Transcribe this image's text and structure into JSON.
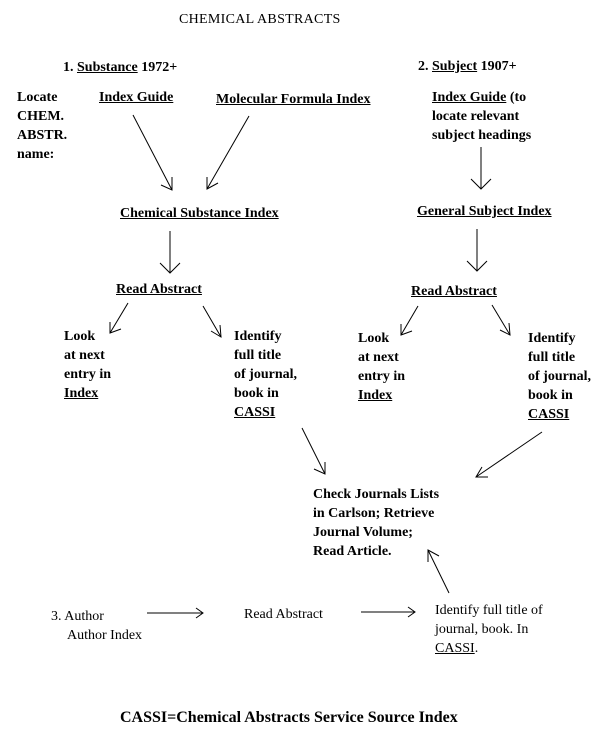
{
  "title": "CHEMICAL   ABSTRACTS",
  "section1": {
    "number": "1.",
    "name": "Substance",
    "years": "1972+",
    "locate_lines": [
      "Locate",
      "CHEM.",
      "ABSTR.",
      "name:"
    ],
    "index_guide": "Index Guide",
    "molecular_formula_index": "Molecular Formula Index",
    "chemical_substance_index": "Chemical Substance Index",
    "read_abstract": "Read Abstract",
    "look_lines": [
      "Look",
      "at next",
      "entry in"
    ],
    "look_index": "Index",
    "identify_lines": [
      "Identify",
      "full title",
      "of journal,",
      "book in"
    ],
    "identify_cassi": "CASSI"
  },
  "section2": {
    "number": "2.",
    "name": "Subject",
    "years": "1907+",
    "index_guide": "Index Guide",
    "index_guide_note": " (to",
    "note_lines": [
      "locate relevant",
      "subject headings"
    ],
    "general_subject_index": "General Subject Index",
    "read_abstract": "Read Abstract",
    "look_lines": [
      "Look",
      "at next",
      "entry in"
    ],
    "look_index": "Index",
    "identify_lines": [
      "Identify",
      "full title",
      "of journal,",
      "book in"
    ],
    "identify_cassi": "CASSI"
  },
  "check_journals_lines": [
    "Check Journals Lists",
    "in Carlson; Retrieve",
    "Journal Volume;",
    "Read Article."
  ],
  "section3": {
    "line1": "3. Author",
    "line2": "Author Index",
    "read_abstract": "Read Abstract",
    "identify_lines": [
      "Identify full title of",
      "journal, book.  In"
    ],
    "identify_cassi": "CASSI",
    "identify_end": "."
  },
  "footnote": "CASSI=Chemical Abstracts Service Source Index"
}
